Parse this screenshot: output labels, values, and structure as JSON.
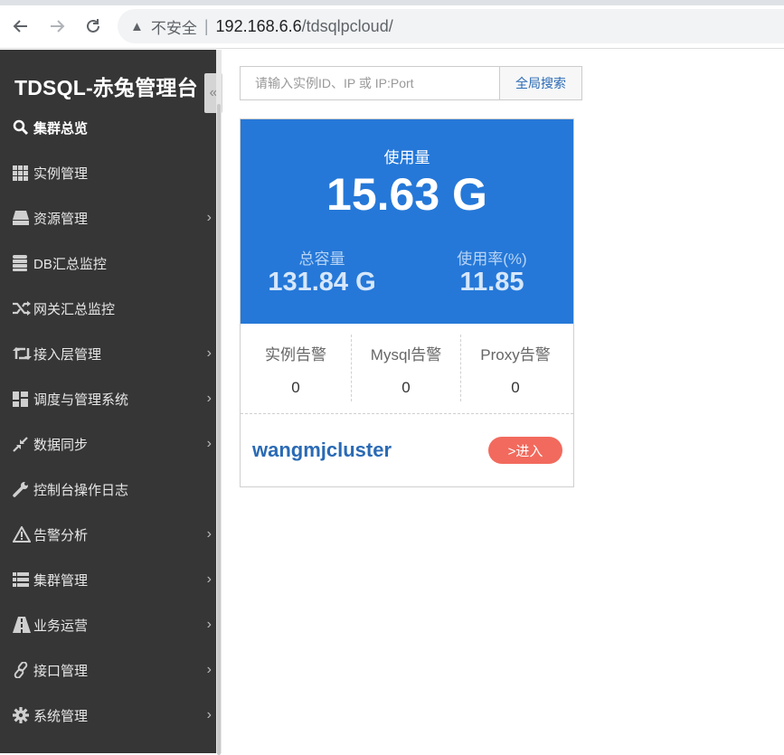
{
  "browser": {
    "security_label": "不安全",
    "url_host": "192.168.6.6",
    "url_path": "/tdsqlpcloud/"
  },
  "sidebar": {
    "brand": "TDSQL-赤兔管理台",
    "items": [
      {
        "label": "集群总览",
        "icon": "search-icon",
        "has_children": false,
        "active": true
      },
      {
        "label": "实例管理",
        "icon": "grid-icon",
        "has_children": false
      },
      {
        "label": "资源管理",
        "icon": "drive-icon",
        "has_children": true
      },
      {
        "label": "DB汇总监控",
        "icon": "database-icon",
        "has_children": false
      },
      {
        "label": "网关汇总监控",
        "icon": "shuffle-icon",
        "has_children": false
      },
      {
        "label": "接入层管理",
        "icon": "retweet-icon",
        "has_children": true
      },
      {
        "label": "调度与管理系统",
        "icon": "dashboard-icon",
        "has_children": true
      },
      {
        "label": "数据同步",
        "icon": "compress-icon",
        "has_children": true
      },
      {
        "label": "控制台操作日志",
        "icon": "wrench-icon",
        "has_children": false
      },
      {
        "label": "告警分析",
        "icon": "warning-icon",
        "has_children": true
      },
      {
        "label": "集群管理",
        "icon": "list-icon",
        "has_children": true
      },
      {
        "label": "业务运营",
        "icon": "road-icon",
        "has_children": true
      },
      {
        "label": "接口管理",
        "icon": "link-icon",
        "has_children": true
      },
      {
        "label": "系统管理",
        "icon": "gear-icon",
        "has_children": true
      }
    ]
  },
  "search": {
    "placeholder": "请输入实例ID、IP 或 IP:Port",
    "button_label": "全局搜索"
  },
  "cluster_card": {
    "usage_label": "使用量",
    "usage_value": "15.63 G",
    "capacity_label": "总容量",
    "capacity_value": "131.84 G",
    "rate_label": "使用率(%)",
    "rate_value": "11.85",
    "alarms": [
      {
        "label": "实例告警",
        "value": "0"
      },
      {
        "label": "Mysql告警",
        "value": "0"
      },
      {
        "label": "Proxy告警",
        "value": "0"
      }
    ],
    "cluster_name": "wangmjcluster",
    "enter_label": ">进入"
  }
}
